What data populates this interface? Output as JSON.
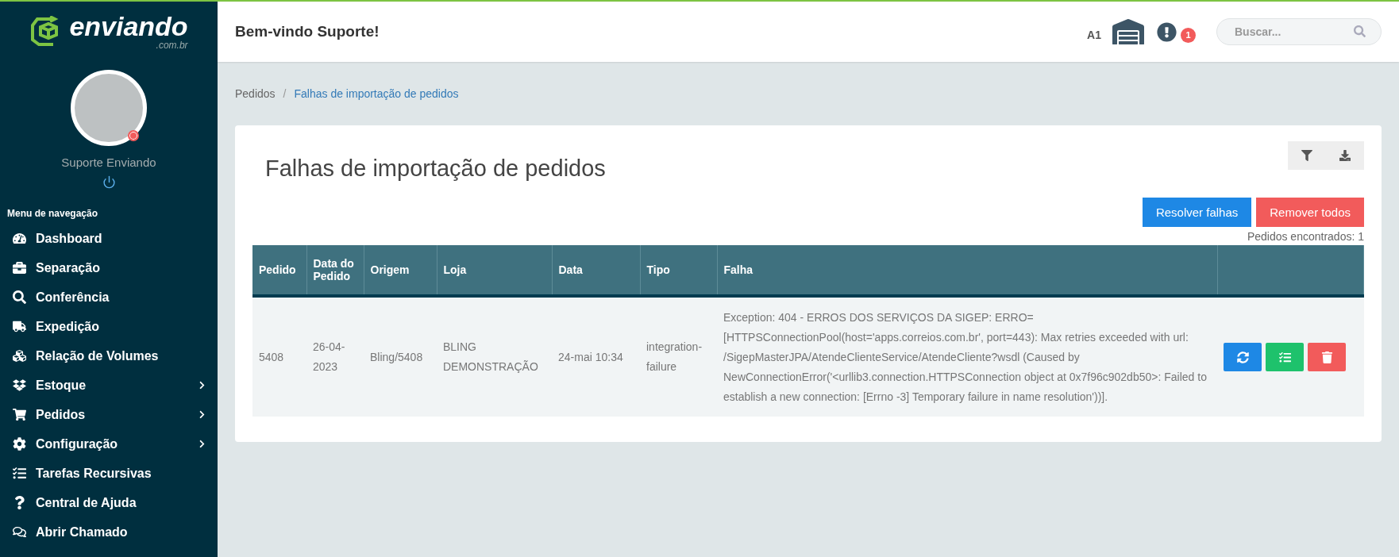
{
  "brand": {
    "name": "enviando",
    "domain": ".com.br"
  },
  "user": {
    "name": "Suporte Enviando",
    "online": false
  },
  "sidebar": {
    "heading": "Menu de navegação",
    "items": [
      {
        "label": "Dashboard",
        "expandable": false
      },
      {
        "label": "Separação",
        "expandable": false
      },
      {
        "label": "Conferência",
        "expandable": false
      },
      {
        "label": "Expedição",
        "expandable": false
      },
      {
        "label": "Relação de Volumes",
        "expandable": false
      },
      {
        "label": "Estoque",
        "expandable": true
      },
      {
        "label": "Pedidos",
        "expandable": true
      },
      {
        "label": "Configuração",
        "expandable": true
      },
      {
        "label": "Tarefas Recursivas",
        "expandable": false
      },
      {
        "label": "Central de Ajuda",
        "expandable": false
      },
      {
        "label": "Abrir Chamado",
        "expandable": false
      }
    ]
  },
  "header": {
    "welcome": "Bem-vindo Suporte!",
    "warehouse_code": "A1",
    "alert_count": "1",
    "search": {
      "placeholder": "Buscar..."
    }
  },
  "breadcrumb_separator": "/",
  "breadcrumb": [
    {
      "label": "Pedidos",
      "selected": false
    },
    {
      "label": "Falhas de importação de pedidos",
      "selected": true
    }
  ],
  "card": {
    "title": "Falhas de importação de pedidos",
    "buttons": [
      {
        "label": "Resolver falhas",
        "kind": "primary"
      },
      {
        "label": "Remover todos",
        "kind": "danger"
      }
    ],
    "count": "Pedidos encontrados: 1"
  },
  "table": {
    "columns": [
      "Pedido",
      "Data do Pedido",
      "Origem",
      "Loja",
      "Data",
      "Tipo",
      "Falha"
    ],
    "rows": [
      {
        "cells": [
          "5408",
          "26-04-2023",
          "Bling/5408",
          "BLING DEMONSTRAÇÃO",
          "24-mai 10:34",
          "integration-failure",
          "Exception: 404 - ERROS DOS SERVIÇOS DA SIGEP: ERRO=[HTTPSConnectionPool(host='apps.correios.com.br', port=443): Max retries exceeded with url: /SigepMasterJPA/AtendeClienteService/AtendeCliente?wsdl (Caused by NewConnectionError('<urllib3.connection.HTTPSConnection object at 0x7f96c902db50>: Failed to establish a new connection: [Errno -3] Temporary failure in name resolution'))]."
        ]
      }
    ]
  }
}
